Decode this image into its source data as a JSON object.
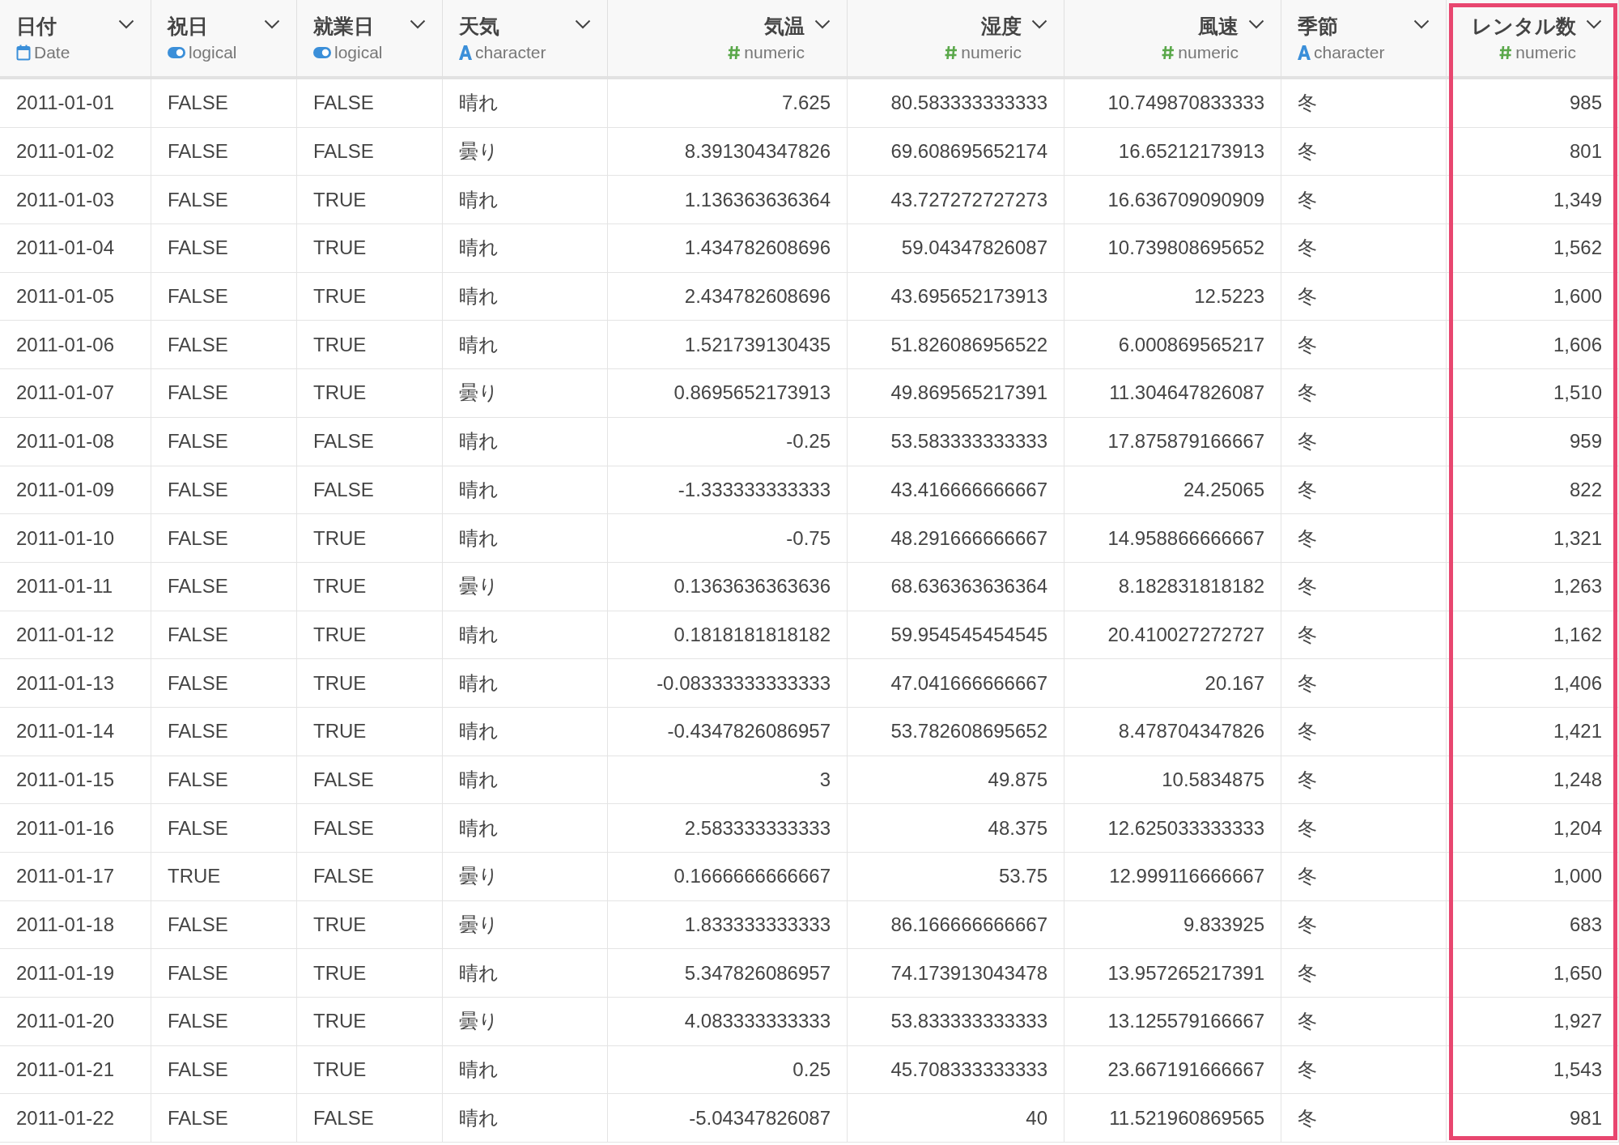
{
  "table": {
    "columns": [
      {
        "label": "日付",
        "kind": "date",
        "type": "Date",
        "highlighted": false
      },
      {
        "label": "祝日",
        "kind": "logical",
        "type": "logical",
        "highlighted": false
      },
      {
        "label": "就業日",
        "kind": "logical",
        "type": "logical",
        "highlighted": false
      },
      {
        "label": "天気",
        "kind": "character",
        "type": "character",
        "highlighted": false
      },
      {
        "label": "気温",
        "kind": "numeric",
        "type": "numeric",
        "highlighted": false
      },
      {
        "label": "湿度",
        "kind": "numeric",
        "type": "numeric",
        "highlighted": false
      },
      {
        "label": "風速",
        "kind": "numeric",
        "type": "numeric",
        "highlighted": false
      },
      {
        "label": "季節",
        "kind": "character",
        "type": "character",
        "highlighted": false
      },
      {
        "label": "レンタル数",
        "kind": "numeric",
        "type": "numeric",
        "highlighted": true
      }
    ],
    "rows": [
      [
        "2011-01-01",
        "FALSE",
        "FALSE",
        "晴れ",
        "7.625",
        "80.583333333333",
        "10.749870833333",
        "冬",
        "985"
      ],
      [
        "2011-01-02",
        "FALSE",
        "FALSE",
        "曇り",
        "8.391304347826",
        "69.608695652174",
        "16.65212173913",
        "冬",
        "801"
      ],
      [
        "2011-01-03",
        "FALSE",
        "TRUE",
        "晴れ",
        "1.136363636364",
        "43.727272727273",
        "16.636709090909",
        "冬",
        "1,349"
      ],
      [
        "2011-01-04",
        "FALSE",
        "TRUE",
        "晴れ",
        "1.434782608696",
        "59.04347826087",
        "10.739808695652",
        "冬",
        "1,562"
      ],
      [
        "2011-01-05",
        "FALSE",
        "TRUE",
        "晴れ",
        "2.434782608696",
        "43.695652173913",
        "12.5223",
        "冬",
        "1,600"
      ],
      [
        "2011-01-06",
        "FALSE",
        "TRUE",
        "晴れ",
        "1.521739130435",
        "51.826086956522",
        "6.000869565217",
        "冬",
        "1,606"
      ],
      [
        "2011-01-07",
        "FALSE",
        "TRUE",
        "曇り",
        "0.8695652173913",
        "49.869565217391",
        "11.304647826087",
        "冬",
        "1,510"
      ],
      [
        "2011-01-08",
        "FALSE",
        "FALSE",
        "晴れ",
        "-0.25",
        "53.583333333333",
        "17.875879166667",
        "冬",
        "959"
      ],
      [
        "2011-01-09",
        "FALSE",
        "FALSE",
        "晴れ",
        "-1.333333333333",
        "43.416666666667",
        "24.25065",
        "冬",
        "822"
      ],
      [
        "2011-01-10",
        "FALSE",
        "TRUE",
        "晴れ",
        "-0.75",
        "48.291666666667",
        "14.958866666667",
        "冬",
        "1,321"
      ],
      [
        "2011-01-11",
        "FALSE",
        "TRUE",
        "曇り",
        "0.1363636363636",
        "68.636363636364",
        "8.182831818182",
        "冬",
        "1,263"
      ],
      [
        "2011-01-12",
        "FALSE",
        "TRUE",
        "晴れ",
        "0.1818181818182",
        "59.954545454545",
        "20.410027272727",
        "冬",
        "1,162"
      ],
      [
        "2011-01-13",
        "FALSE",
        "TRUE",
        "晴れ",
        "-0.08333333333333",
        "47.041666666667",
        "20.167",
        "冬",
        "1,406"
      ],
      [
        "2011-01-14",
        "FALSE",
        "TRUE",
        "晴れ",
        "-0.4347826086957",
        "53.782608695652",
        "8.478704347826",
        "冬",
        "1,421"
      ],
      [
        "2011-01-15",
        "FALSE",
        "FALSE",
        "晴れ",
        "3",
        "49.875",
        "10.5834875",
        "冬",
        "1,248"
      ],
      [
        "2011-01-16",
        "FALSE",
        "FALSE",
        "晴れ",
        "2.583333333333",
        "48.375",
        "12.625033333333",
        "冬",
        "1,204"
      ],
      [
        "2011-01-17",
        "TRUE",
        "FALSE",
        "曇り",
        "0.1666666666667",
        "53.75",
        "12.999116666667",
        "冬",
        "1,000"
      ],
      [
        "2011-01-18",
        "FALSE",
        "TRUE",
        "曇り",
        "1.833333333333",
        "86.166666666667",
        "9.833925",
        "冬",
        "683"
      ],
      [
        "2011-01-19",
        "FALSE",
        "TRUE",
        "晴れ",
        "5.347826086957",
        "74.173913043478",
        "13.957265217391",
        "冬",
        "1,650"
      ],
      [
        "2011-01-20",
        "FALSE",
        "TRUE",
        "曇り",
        "4.083333333333",
        "53.833333333333",
        "13.125579166667",
        "冬",
        "1,927"
      ],
      [
        "2011-01-21",
        "FALSE",
        "TRUE",
        "晴れ",
        "0.25",
        "45.708333333333",
        "23.667191666667",
        "冬",
        "1,543"
      ],
      [
        "2011-01-22",
        "FALSE",
        "FALSE",
        "晴れ",
        "-5.04347826087",
        "40",
        "11.521960869565",
        "冬",
        "981"
      ]
    ]
  }
}
